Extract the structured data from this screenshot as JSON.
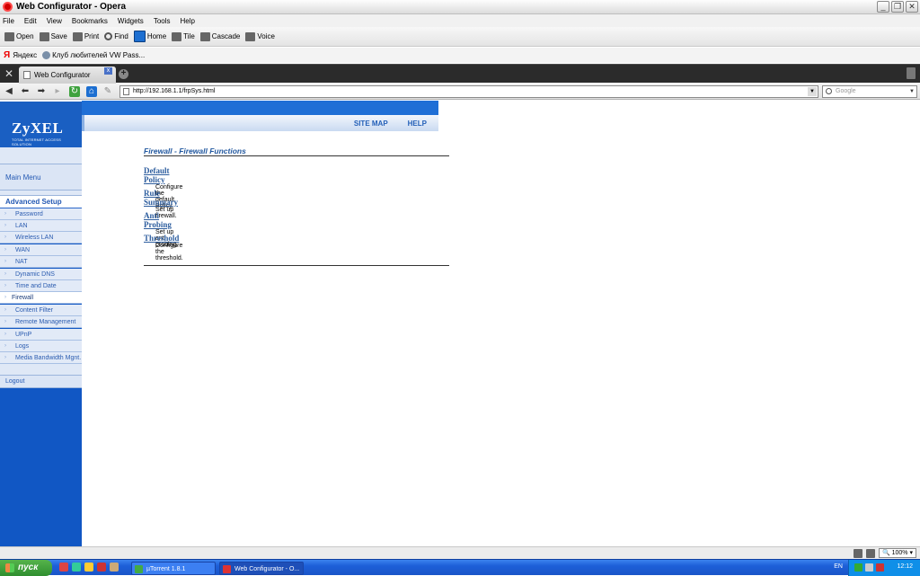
{
  "window": {
    "title": "Web Configurator - Opera"
  },
  "menu": [
    "File",
    "Edit",
    "View",
    "Bookmarks",
    "Widgets",
    "Tools",
    "Help"
  ],
  "toolbar": [
    {
      "label": "Open",
      "icon": "folder-icon"
    },
    {
      "label": "Save",
      "icon": "disk-icon"
    },
    {
      "label": "Print",
      "icon": "printer-icon"
    },
    {
      "label": "Find",
      "icon": "magnifier-icon"
    },
    {
      "label": "Home",
      "icon": "home-icon"
    },
    {
      "label": "Tile",
      "icon": "tile-icon"
    },
    {
      "label": "Cascade",
      "icon": "cascade-icon"
    },
    {
      "label": "Voice",
      "icon": "voice-icon"
    }
  ],
  "bookmarks": [
    "Яндекс",
    "Клуб любителей VW Pass..."
  ],
  "tabs": [
    {
      "label": "Web Configurator"
    }
  ],
  "address": {
    "url": "http://192.168.1.1/frpSys.html",
    "search_placeholder": "Google"
  },
  "page": {
    "logo": "ZyXEL",
    "logo_tagline": "TOTAL INTERNET ACCESS SOLUTION",
    "top_links": [
      "SITE MAP",
      "HELP"
    ],
    "title": "Firewall - Firewall Functions",
    "sections": [
      {
        "link": "Default Policy",
        "desc": "Configure the default Policy."
      },
      {
        "link": "Rule Summary",
        "desc": "Set up firewall."
      },
      {
        "link": "Anti Probing",
        "desc": "Set up anti probing."
      },
      {
        "link": "Threshold",
        "desc": "Configure the threshold."
      }
    ]
  },
  "sidebar": {
    "main_menu": "Main Menu",
    "advanced": "Advanced Setup",
    "items": [
      "Password",
      "LAN",
      "Wireless LAN",
      "WAN",
      "NAT",
      "Dynamic DNS",
      "Time and Date",
      "Firewall",
      "Content Filter",
      "Remote Management",
      "UPnP",
      "Logs",
      "Media Bandwidth Mgnt."
    ],
    "active": "Firewall",
    "logout": "Logout"
  },
  "status": {
    "zoom": "100%"
  },
  "taskbar": {
    "start": "пуск",
    "tasks": [
      "µTorrent 1.8.1",
      "Web Configurator - O..."
    ],
    "lang": "EN",
    "clock": "12:12"
  }
}
